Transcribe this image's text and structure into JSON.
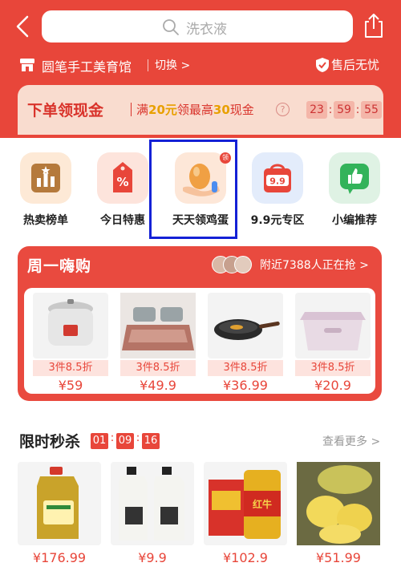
{
  "header": {
    "search_placeholder": "洗衣液",
    "store_name": "圆笔手工美育馆",
    "switch_label": "切换 >",
    "after_sale": "售后无忧",
    "brand_color": "#e8463a"
  },
  "cash_banner": {
    "title": "下单领现金",
    "desc_prefix": "满",
    "desc_amount1": "20元",
    "desc_middle": "领最高",
    "desc_amount2": "30",
    "desc_suffix": "现金",
    "help": "?",
    "timer": {
      "h": "23",
      "m": "59",
      "s": "55"
    }
  },
  "categories": [
    {
      "label": "热卖榜单",
      "icon": "ranking-chart-icon"
    },
    {
      "label": "今日特惠",
      "icon": "discount-tag-icon"
    },
    {
      "label": "天天领鸡蛋",
      "icon": "egg-in-hand-icon",
      "badge": "领",
      "highlighted": true
    },
    {
      "label": "9.9元专区",
      "icon": "shopping-bag-icon"
    },
    {
      "label": "小编推荐",
      "icon": "thumbs-up-icon"
    }
  ],
  "weekly": {
    "title": "周一嗨购",
    "nearby": "附近7388人正在抢 >",
    "items": [
      {
        "tag": "3件8.5折",
        "price": "¥59",
        "icon": "rice-cooker-image"
      },
      {
        "tag": "3件8.5折",
        "price": "¥49.9",
        "icon": "bed-mat-image"
      },
      {
        "tag": "3件8.5折",
        "price": "¥36.99",
        "icon": "wok-pan-image"
      },
      {
        "tag": "3件8.5折",
        "price": "¥20.9",
        "icon": "storage-box-image"
      }
    ]
  },
  "flash_sale": {
    "title": "限时秒杀",
    "timer": {
      "h": "01",
      "m": "09",
      "s": "16"
    },
    "see_more": "查看更多 >",
    "items": [
      {
        "price": "¥176.99",
        "icon": "cooking-oil-image"
      },
      {
        "price": "¥9.9",
        "icon": "detergent-bottles-image"
      },
      {
        "price": "¥102.9",
        "icon": "energy-drink-image"
      },
      {
        "price": "¥51.99",
        "icon": "durian-image"
      }
    ]
  }
}
